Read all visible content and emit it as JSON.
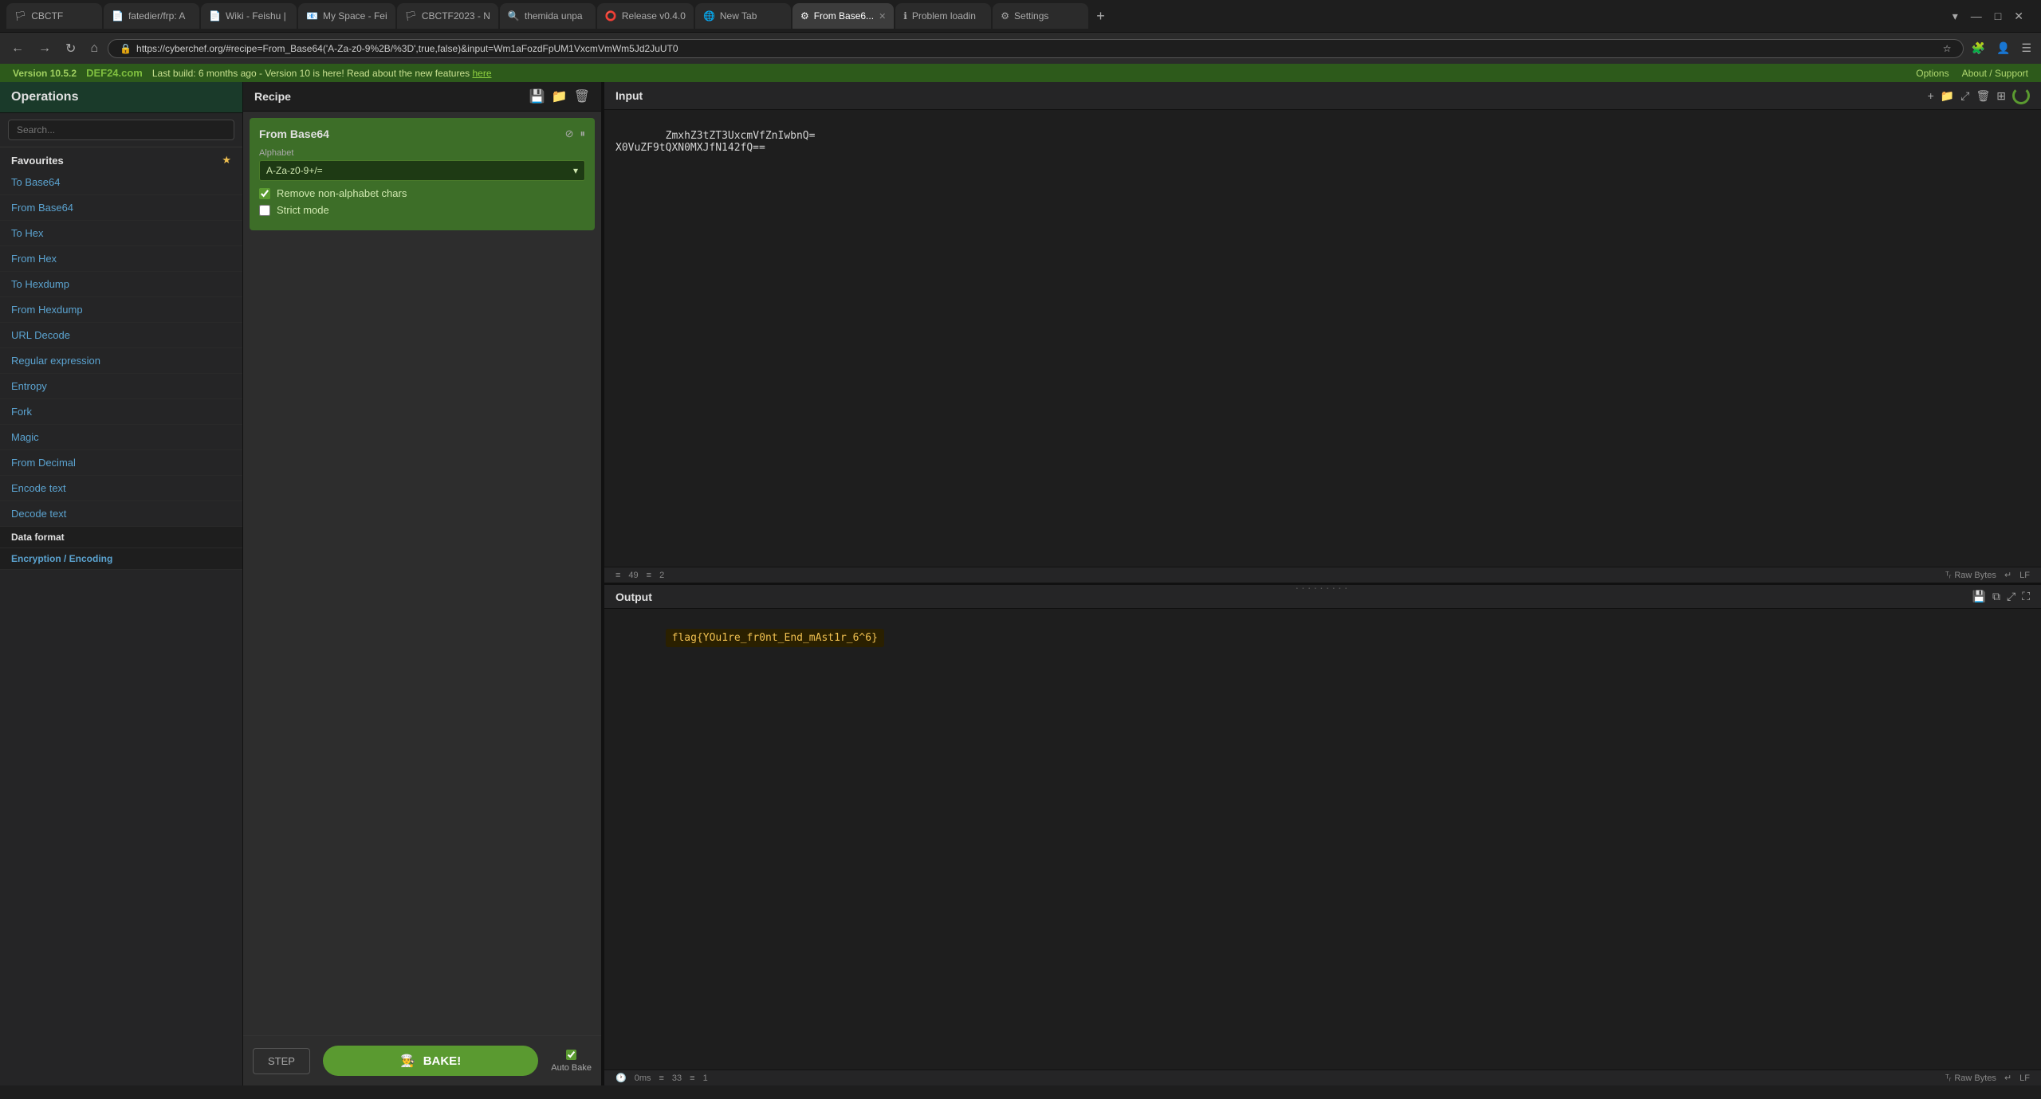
{
  "browser": {
    "tabs": [
      {
        "id": "cbctf",
        "label": "CBCTF",
        "favicon": "🏳",
        "active": false
      },
      {
        "id": "fatedier",
        "label": "fatedier/frp: A",
        "favicon": "📄",
        "active": false
      },
      {
        "id": "wiki-feishu",
        "label": "Wiki - Feishu |",
        "favicon": "📄",
        "active": false
      },
      {
        "id": "myspace",
        "label": "My Space - Fei",
        "favicon": "📧",
        "active": false
      },
      {
        "id": "cbctf2023",
        "label": "CBCTF2023 - N",
        "favicon": "🏳",
        "active": false
      },
      {
        "id": "themida",
        "label": "themida unpa",
        "favicon": "🔍",
        "active": false
      },
      {
        "id": "release",
        "label": "Release v0.4.0",
        "favicon": "⭕",
        "active": false
      },
      {
        "id": "newtab",
        "label": "New Tab",
        "favicon": "🌐",
        "active": false
      },
      {
        "id": "frombase64",
        "label": "From Base6...",
        "favicon": "⚙",
        "active": true
      },
      {
        "id": "problemloading",
        "label": "Problem loadin",
        "favicon": "ℹ",
        "active": false
      },
      {
        "id": "settings",
        "label": "Settings",
        "favicon": "⚙",
        "active": false
      }
    ],
    "address": "https://cyberchef.org/#recipe=From_Base64('A-Za-z0-9%2B/%3D',true,false)&input=Wm1aFozdFpUM1VxcmVmWm5Jd2JuUT0",
    "version": "Version 10.5.2",
    "site": "DEF24.com",
    "build_info": "Last build: 6 months ago - Version 10 is here! Read about the new features",
    "build_link": "here",
    "options_label": "Options",
    "about_support_label": "About / Support"
  },
  "sidebar": {
    "header": "Operations",
    "search_placeholder": "Search...",
    "favourites_label": "Favourites",
    "items": [
      {
        "id": "to-base64",
        "label": "To Base64"
      },
      {
        "id": "from-base64",
        "label": "From Base64"
      },
      {
        "id": "to-hex",
        "label": "To Hex"
      },
      {
        "id": "from-hex",
        "label": "From Hex"
      },
      {
        "id": "to-hexdump",
        "label": "To Hexdump"
      },
      {
        "id": "from-hexdump",
        "label": "From Hexdump"
      },
      {
        "id": "url-decode",
        "label": "URL Decode"
      },
      {
        "id": "regular-expression",
        "label": "Regular expression"
      },
      {
        "id": "entropy",
        "label": "Entropy"
      },
      {
        "id": "fork",
        "label": "Fork"
      },
      {
        "id": "magic",
        "label": "Magic"
      },
      {
        "id": "from-decimal",
        "label": "From Decimal"
      },
      {
        "id": "encode-text",
        "label": "Encode text"
      },
      {
        "id": "decode-text",
        "label": "Decode text"
      }
    ],
    "section_data_format": "Data format",
    "section_encryption": "Encryption / Encoding"
  },
  "recipe": {
    "title": "Recipe",
    "op_title": "From Base64",
    "alphabet_label": "Alphabet",
    "alphabet_value": "A-Za-z0-9+/=",
    "remove_nonalphabet_label": "Remove non-alphabet chars",
    "remove_nonalphabet_checked": true,
    "strict_mode_label": "Strict mode",
    "strict_mode_checked": false,
    "step_label": "STEP",
    "bake_label": "BAKE!",
    "autobake_label": "Auto Bake",
    "autobake_checked": true
  },
  "input": {
    "title": "Input",
    "content": "ZmxhZ3tZT3UxcmVfZnIwbnQ=\nX0VuZF9tQXN0MXJfN142fQ==",
    "stat_chars": "49",
    "stat_lines": "2",
    "encoding": "Raw Bytes",
    "lineending": "LF"
  },
  "output": {
    "title": "Output",
    "content": "flag{YOu1re_fr0nt_End_mAst1r_6^6}",
    "stat_chars": "33",
    "stat_lines": "1",
    "time": "0ms",
    "encoding": "Raw Bytes",
    "lineending": "LF"
  },
  "icons": {
    "save": "💾",
    "folder": "📁",
    "trash": "🗑",
    "plus": "+",
    "copy": "⧉",
    "expand": "⤢",
    "fullscreen": "⛶",
    "back": "←",
    "forward": "→",
    "refresh": "↻",
    "home": "⌂",
    "menu": "☰",
    "star": "★",
    "disable": "⊘",
    "pause": "⏸",
    "chevron_down": "▾",
    "check": "✓",
    "minimize": "—",
    "maximize": "□",
    "close": "✕",
    "new_tab": "+"
  }
}
